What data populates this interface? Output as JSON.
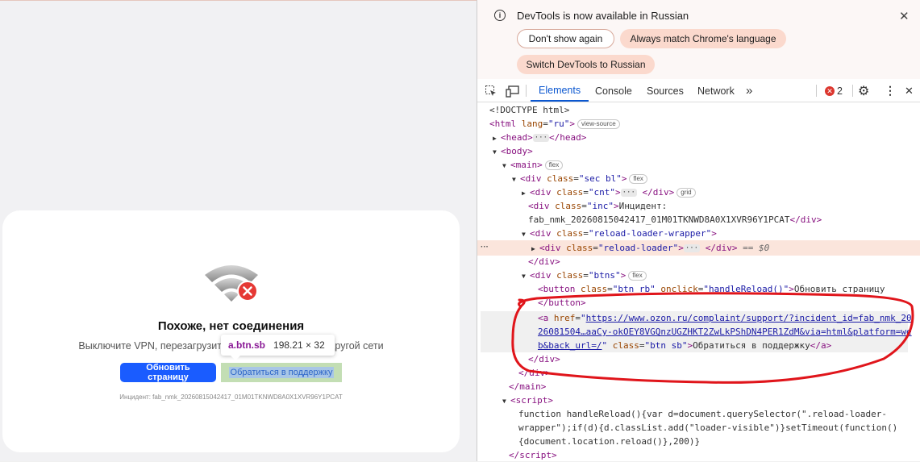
{
  "page": {
    "error_title": "Похоже, нет соединения",
    "error_subtitle_left": "Выключите VPN, перезагрузите ро",
    "error_subtitle_right": "к другой сети",
    "reload_button": "Обновить страницу",
    "support_button": "Обратиться в поддержку",
    "incident": "Инцидент: fab_nmk_20260815042417_01M01TKNWD8A0X1XVR96Y1PCAT",
    "icons": {
      "wifi": "wifi-off-icon",
      "error": "error-x-icon"
    }
  },
  "tooltip": {
    "name": "a.btn.sb",
    "size": "198.21 × 32"
  },
  "devtools": {
    "notice": {
      "message": "DevTools is now available in Russian",
      "dont_show": "Don't show again",
      "match_language": "Always match Chrome's language",
      "switch": "Switch DevTools to Russian"
    },
    "tabs": [
      "Elements",
      "Console",
      "Sources",
      "Network"
    ],
    "more_tabs": "»",
    "error_count": "2",
    "dom": {
      "doctype": "<!DOCTYPE html>",
      "view_source": "view-source",
      "flex": "flex",
      "grid": "grid",
      "eq0": "== $0",
      "inc_text_1": "Инцидент:",
      "inc_text_2": "fab_nmk_20260815042417_01M01TKNWD8A0X1XVR96Y1PCAT",
      "button_text": "Обновить страницу",
      "onclick": "handleReload()",
      "href_1": "https://www.ozon.ru/complaint/support/?incident_id=fab_nmk_20",
      "href_2": "26081504…aaCy-okOEY8VGQnzUGZHKT2ZwLkPShDN4PER1ZdM&via=html&platform=we",
      "href_3": "b&back_url=/",
      "a_text": "Обратиться в поддержку",
      "script_1": "function handleReload(){var d=document.querySelector(\".reload-loader-",
      "script_2": "wrapper\");if(d){d.classList.add(\"loader-visible\")}setTimeout(function()",
      "script_3": "{document.location.reload()},200)}"
    }
  },
  "colors": {
    "accent": "#1a5cff",
    "annotation": "#e0151b",
    "tag": "#881280"
  }
}
